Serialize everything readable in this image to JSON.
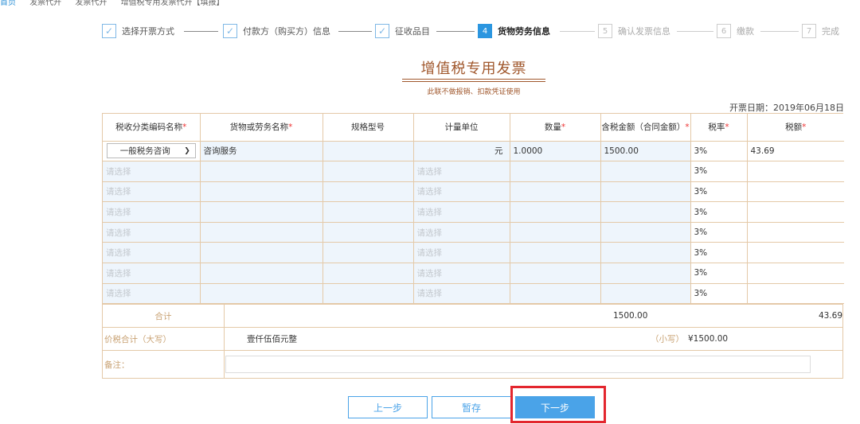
{
  "breadcrumb": [
    "首页",
    "发票代开",
    "发票代开",
    "增值税专用发票代开【填报】"
  ],
  "steps": [
    {
      "num": "1",
      "label": "选择开票方式",
      "status": "done"
    },
    {
      "num": "2",
      "label": "付款方（购买方）信息",
      "status": "done"
    },
    {
      "num": "3",
      "label": "征收品目",
      "status": "done"
    },
    {
      "num": "4",
      "label": "货物劳务信息",
      "status": "active"
    },
    {
      "num": "5",
      "label": "确认发票信息",
      "status": "todo"
    },
    {
      "num": "6",
      "label": "缴款",
      "status": "todo"
    },
    {
      "num": "7",
      "label": "完成",
      "status": "todo"
    }
  ],
  "invoice": {
    "title": "增值税专用发票",
    "subtitle": "此联不做报销、扣款凭证使用",
    "date_label": "开票日期：2019年06月18日",
    "columns": [
      "税收分类编码名称",
      "货物或劳务名称",
      "规格型号",
      "计量单位",
      "数量",
      "含税金额（合同金额）",
      "税率",
      "税额"
    ],
    "required_mark": "*",
    "rows": [
      {
        "category": "一般税务咨询",
        "name": "咨询服务",
        "spec": "",
        "unit": "元",
        "qty": "1.0000",
        "amount": "1500.00",
        "rate": "3%",
        "tax": "43.69"
      },
      {
        "category": "请选择",
        "name": "",
        "spec": "",
        "unit": "请选择",
        "qty": "",
        "amount": "",
        "rate": "3%",
        "tax": ""
      },
      {
        "category": "请选择",
        "name": "",
        "spec": "",
        "unit": "请选择",
        "qty": "",
        "amount": "",
        "rate": "3%",
        "tax": ""
      },
      {
        "category": "请选择",
        "name": "",
        "spec": "",
        "unit": "请选择",
        "qty": "",
        "amount": "",
        "rate": "3%",
        "tax": ""
      },
      {
        "category": "请选择",
        "name": "",
        "spec": "",
        "unit": "请选择",
        "qty": "",
        "amount": "",
        "rate": "3%",
        "tax": ""
      },
      {
        "category": "请选择",
        "name": "",
        "spec": "",
        "unit": "请选择",
        "qty": "",
        "amount": "",
        "rate": "3%",
        "tax": ""
      },
      {
        "category": "请选择",
        "name": "",
        "spec": "",
        "unit": "请选择",
        "qty": "",
        "amount": "",
        "rate": "3%",
        "tax": ""
      },
      {
        "category": "请选择",
        "name": "",
        "spec": "",
        "unit": "请选择",
        "qty": "",
        "amount": "",
        "rate": "3%",
        "tax": ""
      }
    ],
    "total_label": "合计",
    "total_amount": "1500.00",
    "total_tax": "43.69",
    "grand_label": "价税合计（大写）",
    "grand_upper": "壹仟伍佰元整",
    "grand_small_label": "（小写）",
    "grand_small_value": "¥1500.00",
    "remark_label": "备注："
  },
  "buttons": {
    "prev": "上一步",
    "save": "暂存",
    "next": "下一步"
  },
  "colors": {
    "accent": "#4aa3e8",
    "invoice_brown": "#a0572c",
    "highlight": "#e3262e"
  }
}
